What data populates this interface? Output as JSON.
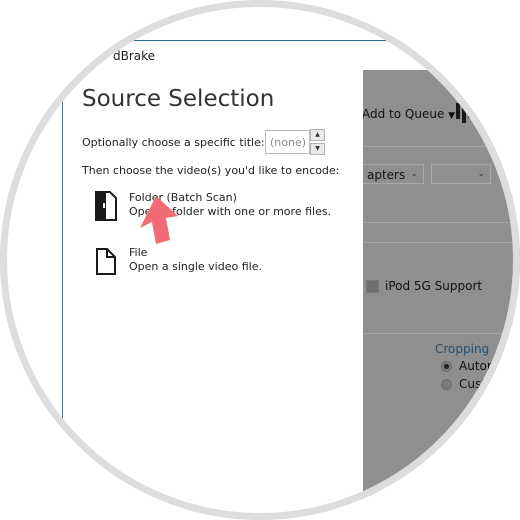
{
  "window": {
    "title_partial": "dBrake"
  },
  "toolbar": {
    "add_to_queue": "Add to Queue"
  },
  "main": {
    "chapters_fragment": "apters",
    "ipod_label": "iPod 5G Support",
    "cropping": {
      "heading": "Cropping",
      "options": [
        "Autom",
        "Cust"
      ],
      "selected": "Autom"
    },
    "accent_color": "#2e6b8a"
  },
  "dialog": {
    "title": "Source Selection",
    "title_prompt": "Optionally choose a specific title:",
    "title_value": "(none)",
    "encode_prompt": "Then choose the video(s) you'd like to encode:",
    "folder": {
      "title": "Folder (Batch Scan)",
      "description": "Open a folder with one or more files."
    },
    "file": {
      "title": "File",
      "description": "Open a single video file."
    },
    "arrow_color": "#f06b74"
  },
  "icons": [
    "folder-icon",
    "file-icon",
    "queue-icon",
    "dropdown-arrow-icon",
    "spinner-up-icon",
    "spinner-down-icon",
    "pointer-arrow-icon"
  ]
}
